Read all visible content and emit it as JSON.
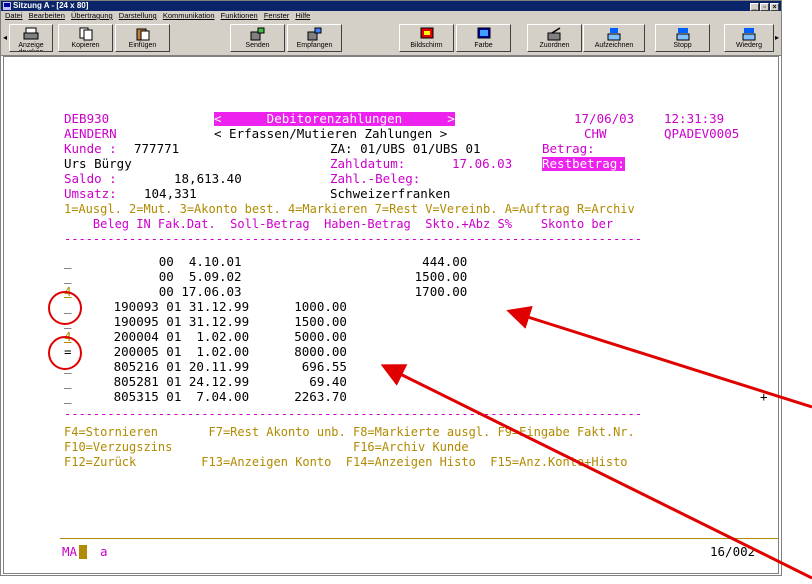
{
  "window": {
    "title": "Sitzung A - [24 x 80]"
  },
  "menu": [
    "Datei",
    "Bearbeiten",
    "Übertragung",
    "Darstellung",
    "Kommunikation",
    "Funktionen",
    "Fenster",
    "Hilfe"
  ],
  "toolbar": [
    {
      "label": "Anzeige drucken",
      "icon": "printer-icon"
    },
    {
      "label": "Kopieren",
      "icon": "copy-icon"
    },
    {
      "label": "Einfügen",
      "icon": "paste-icon"
    },
    {
      "label": "Senden",
      "icon": "send-icon"
    },
    {
      "label": "Empfangen",
      "icon": "receive-icon"
    },
    {
      "label": "Bildschirm",
      "icon": "screen-icon"
    },
    {
      "label": "Farbe",
      "icon": "color-icon"
    },
    {
      "label": "Zuordnen",
      "icon": "map-icon"
    },
    {
      "label": "Aufzeichnen",
      "icon": "record-icon"
    },
    {
      "label": "Stopp",
      "icon": "stop-icon"
    },
    {
      "label": "Wiederg",
      "icon": "play-icon"
    }
  ],
  "terminal": {
    "row1": {
      "program": "DEB930",
      "title": "<      Debitorenzahlungen      >",
      "date": "17/06/03",
      "time": "12:31:39"
    },
    "row2": {
      "mode": "AENDERN",
      "subtitle": "< Erfassen/Mutieren Zahlungen >",
      "user": "CHW",
      "device": "QPADEV0005"
    },
    "row3": {
      "kunde_label": "Kunde : ",
      "kunde_value": "777771",
      "za": "ZA: 01/UBS 01/UBS 01",
      "betrag_label": "Betrag:"
    },
    "row4": {
      "name": "Urs Bürgy",
      "zahldatum_label": "Zahldatum:",
      "zahldatum_value": "17.06.03",
      "restbetrag_label": "Restbetrag:"
    },
    "row5": {
      "saldo_label": "Saldo :",
      "saldo_value": "18,613.40",
      "beleg_label": "Zahl.-Beleg:"
    },
    "row6": {
      "umsatz_label": "Umsatz:",
      "umsatz_value": "104,331",
      "currency": "Schweizerfranken"
    },
    "options": "1=Ausgl. 2=Mut. 3=Akonto best. 4=Markieren 7=Rest V=Vereinb. A=Auftrag R=Archiv",
    "header": "    Beleg IN Fak.Dat.  Soll-Betrag  Haben-Betrag  Skto.+Abz S%    Skonto ber",
    "separator": "--------------------------------------------------------------------------------",
    "rows": [
      {
        "sel": "_",
        "text": "           00  4.10.01                        444.00"
      },
      {
        "sel": "_",
        "text": "           00  5.09.02                       1500.00"
      },
      {
        "sel": "4",
        "text": "           00 17.06.03                       1700.00"
      },
      {
        "sel": "_",
        "text": "     190093 01 31.12.99      1000.00"
      },
      {
        "sel": "_",
        "text": "     190095 01 31.12.99      1500.00"
      },
      {
        "sel": "4",
        "text": "     200004 01  1.02.00      5000.00"
      },
      {
        "sel": "=",
        "text": "     200005 01  1.02.00      8000.00"
      },
      {
        "sel": "_",
        "text": "     805216 01 20.11.99       696.55"
      },
      {
        "sel": "_",
        "text": "     805281 01 24.12.99        69.40"
      },
      {
        "sel": "_",
        "text": "     805315 01  7.04.00      2263.70"
      }
    ],
    "more_indicator": "+",
    "fkeys": [
      "F4=Stornieren       F7=Rest Akonto unb. F8=Markierte ausgl. F9=Eingabe Fakt.Nr.",
      "F10=Verzugszins                         F16=Archiv Kunde",
      "F12=Zurück         F13=Anzeigen Konto  F14=Anzeigen Histo  F15=Anz.Konto+Histo"
    ],
    "status": {
      "left": "MA",
      "input": "a",
      "right": "16/002"
    }
  },
  "colors": {
    "titlebar": "#0a246a",
    "annotation": "#e00000",
    "magenta": "#cc00cc",
    "yellow": "#b08a00"
  }
}
